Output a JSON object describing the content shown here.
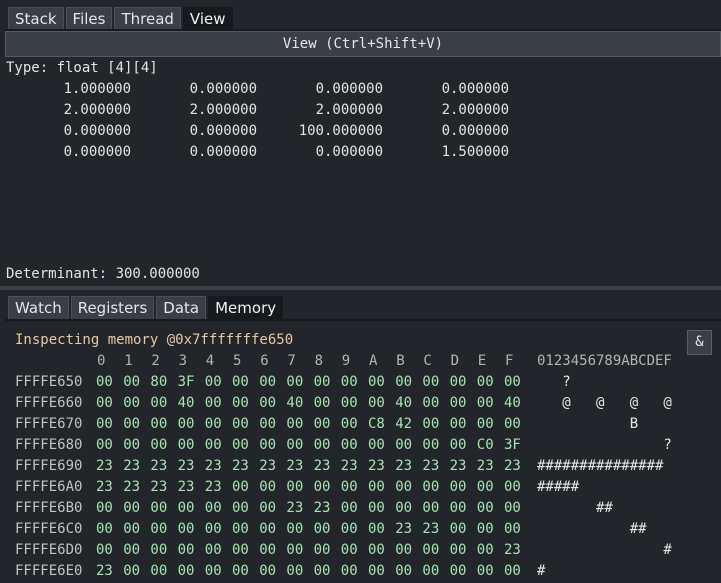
{
  "top_tabs": [
    "Stack",
    "Files",
    "Thread",
    "View"
  ],
  "top_active_tab": 3,
  "view_header": "View (Ctrl+Shift+V)",
  "type_label": "Type: float [4][4]",
  "matrix": [
    [
      "1.000000",
      "0.000000",
      "0.000000",
      "0.000000"
    ],
    [
      "2.000000",
      "2.000000",
      "2.000000",
      "2.000000"
    ],
    [
      "0.000000",
      "0.000000",
      "100.000000",
      "0.000000"
    ],
    [
      "0.000000",
      "0.000000",
      "0.000000",
      "1.500000"
    ]
  ],
  "determinant": "Determinant: 300.000000",
  "bottom_tabs": [
    "Watch",
    "Registers",
    "Data",
    "Memory"
  ],
  "bottom_active_tab": 3,
  "inspect_label": "Inspecting memory @0x7fffffffe650",
  "amp_button_label": "&",
  "memory": {
    "column_headers": [
      "0",
      "1",
      "2",
      "3",
      "4",
      "5",
      "6",
      "7",
      "8",
      "9",
      "A",
      "B",
      "C",
      "D",
      "E",
      "F"
    ],
    "ascii_header": "0123456789ABCDEF",
    "rows": [
      {
        "address": "FFFFE650",
        "bytes": [
          "00",
          "00",
          "80",
          "3F",
          "00",
          "00",
          "00",
          "00",
          "00",
          "00",
          "00",
          "00",
          "00",
          "00",
          "00",
          "00"
        ],
        "ascii": "   ?            "
      },
      {
        "address": "FFFFE660",
        "bytes": [
          "00",
          "00",
          "00",
          "40",
          "00",
          "00",
          "00",
          "40",
          "00",
          "00",
          "00",
          "40",
          "00",
          "00",
          "00",
          "40"
        ],
        "ascii": "   @   @   @   @"
      },
      {
        "address": "FFFFE670",
        "bytes": [
          "00",
          "00",
          "00",
          "00",
          "00",
          "00",
          "00",
          "00",
          "00",
          "00",
          "C8",
          "42",
          "00",
          "00",
          "00",
          "00"
        ],
        "ascii": "           B    "
      },
      {
        "address": "FFFFE680",
        "bytes": [
          "00",
          "00",
          "00",
          "00",
          "00",
          "00",
          "00",
          "00",
          "00",
          "00",
          "00",
          "00",
          "00",
          "00",
          "C0",
          "3F"
        ],
        "ascii": "               ?"
      },
      {
        "address": "FFFFE690",
        "bytes": [
          "23",
          "23",
          "23",
          "23",
          "23",
          "23",
          "23",
          "23",
          "23",
          "23",
          "23",
          "23",
          "23",
          "23",
          "23",
          "23"
        ],
        "ascii": "###############"
      },
      {
        "address": "FFFFE6A0",
        "bytes": [
          "23",
          "23",
          "23",
          "23",
          "23",
          "00",
          "00",
          "00",
          "00",
          "00",
          "00",
          "00",
          "00",
          "00",
          "00",
          "00"
        ],
        "ascii": "#####"
      },
      {
        "address": "FFFFE6B0",
        "bytes": [
          "00",
          "00",
          "00",
          "00",
          "00",
          "00",
          "00",
          "23",
          "23",
          "00",
          "00",
          "00",
          "00",
          "00",
          "00",
          "00"
        ],
        "ascii": "       ##       "
      },
      {
        "address": "FFFFE6C0",
        "bytes": [
          "00",
          "00",
          "00",
          "00",
          "00",
          "00",
          "00",
          "00",
          "00",
          "00",
          "00",
          "23",
          "23",
          "00",
          "00",
          "00"
        ],
        "ascii": "           ##   "
      },
      {
        "address": "FFFFE6D0",
        "bytes": [
          "00",
          "00",
          "00",
          "00",
          "00",
          "00",
          "00",
          "00",
          "00",
          "00",
          "00",
          "00",
          "00",
          "00",
          "00",
          "23"
        ],
        "ascii": "               #"
      },
      {
        "address": "FFFFE6E0",
        "bytes": [
          "23",
          "00",
          "00",
          "00",
          "00",
          "00",
          "00",
          "00",
          "00",
          "00",
          "00",
          "00",
          "00",
          "00",
          "00",
          "00"
        ],
        "ascii": "#               "
      }
    ]
  }
}
